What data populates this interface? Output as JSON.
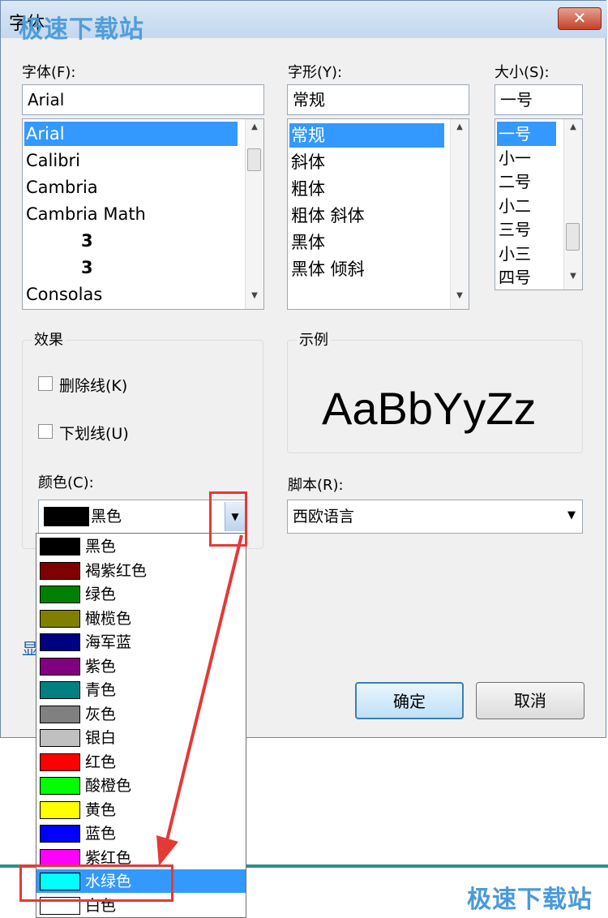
{
  "window": {
    "title": "字体",
    "close_label": "✕"
  },
  "watermark": "极速下载站",
  "font": {
    "label": "字体(F):",
    "value": "Arial",
    "items": [
      "Arial",
      "Calibri",
      "Cambria",
      "Cambria Math",
      "3",
      "3",
      "Consolas"
    ],
    "selected_index": 0
  },
  "style": {
    "label": "字形(Y):",
    "value": "常规",
    "items": [
      "常规",
      "斜体",
      "粗体",
      "粗体 斜体",
      "黑体",
      "黑体 倾斜"
    ],
    "selected_index": 0
  },
  "size": {
    "label": "大小(S):",
    "value": "一号",
    "items": [
      "一号",
      "小一",
      "二号",
      "小二",
      "三号",
      "小三",
      "四号"
    ],
    "selected_index": 0
  },
  "effects": {
    "label": "效果",
    "strikethrough": "删除线(K)",
    "underline": "下划线(U)",
    "color_label": "颜色(C):",
    "color_value": "黑色",
    "color_swatch": "#000000"
  },
  "sample": {
    "label": "示例",
    "text": "AaBbYyZz"
  },
  "script": {
    "label": "脚本(R):",
    "value": "西欧语言"
  },
  "partial_link": "显",
  "buttons": {
    "ok": "确定",
    "cancel": "取消"
  },
  "color_options": [
    {
      "label": "黑色",
      "color": "#000000"
    },
    {
      "label": "褐紫红色",
      "color": "#800000"
    },
    {
      "label": "绿色",
      "color": "#008000"
    },
    {
      "label": "橄榄色",
      "color": "#808000"
    },
    {
      "label": "海军蓝",
      "color": "#000080"
    },
    {
      "label": "紫色",
      "color": "#800080"
    },
    {
      "label": "青色",
      "color": "#008080"
    },
    {
      "label": "灰色",
      "color": "#808080"
    },
    {
      "label": "银白",
      "color": "#c0c0c0"
    },
    {
      "label": "红色",
      "color": "#ff0000"
    },
    {
      "label": "酸橙色",
      "color": "#00ff00"
    },
    {
      "label": "黄色",
      "color": "#ffff00"
    },
    {
      "label": "蓝色",
      "color": "#0000ff"
    },
    {
      "label": "紫红色",
      "color": "#ff00ff"
    },
    {
      "label": "水绿色",
      "color": "#00ffff"
    },
    {
      "label": "白色",
      "color": "#ffffff"
    }
  ],
  "color_selected_index": 14,
  "annotation_color": "#e53935"
}
